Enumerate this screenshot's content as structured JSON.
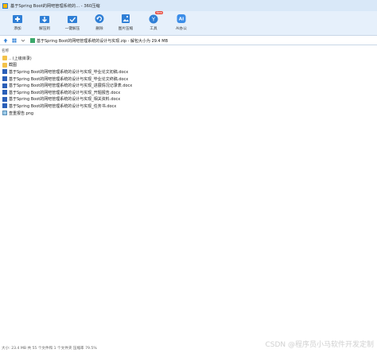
{
  "window": {
    "title": "基于Spring Boot的网吧管理系统的... - 360压缩"
  },
  "toolbar": {
    "items": [
      {
        "label": "添加",
        "icon": "add-icon"
      },
      {
        "label": "解压到",
        "icon": "extract-to-icon"
      },
      {
        "label": "一键解压",
        "icon": "one-click-extract-icon"
      },
      {
        "label": "删除",
        "icon": "delete-icon"
      },
      {
        "label": "图片压缩",
        "icon": "image-compress-icon"
      },
      {
        "label": "工具",
        "icon": "tools-icon",
        "badge": "New"
      },
      {
        "label": "AI办公",
        "icon": "ai-office-icon"
      }
    ]
  },
  "address": {
    "path": "基于Spring Boot的网吧管理系统的设计与实现.zip - 解包大小为 29.4 MB"
  },
  "list": {
    "column_name": "名称",
    "files": [
      {
        "name": ".. (上级目录)",
        "type": "folder"
      },
      {
        "name": "截图",
        "type": "folder"
      },
      {
        "name": "基于Spring Boot的网吧管理系统的设计与实现_毕业论文初稿.docx",
        "type": "doc"
      },
      {
        "name": "基于Spring Boot的网吧管理系统的设计与实现_毕业论文终稿.docx",
        "type": "doc"
      },
      {
        "name": "基于Spring Boot的网吧管理系统的设计与实现_进展情况记录表.docx",
        "type": "doc"
      },
      {
        "name": "基于Spring Boot的网吧管理系统的设计与实现_开题报告.docx",
        "type": "doc"
      },
      {
        "name": "基于Spring Boot的网吧管理系统的设计与实现_相关资料.docx",
        "type": "doc"
      },
      {
        "name": "基于Spring Boot的网吧管理系统的设计与实现_任务书.docx",
        "type": "doc"
      },
      {
        "name": "查重报告.png",
        "type": "img"
      }
    ]
  },
  "status": {
    "text": "大小: 23.4 MB 共 55 个文件和 1 个文件夹 压缩率 79.5%"
  },
  "watermark": "CSDN @程序员小马软件开发定制",
  "colors": {
    "accent": "#2f7fd6",
    "toolbar_bg": "#e6f0fb",
    "badge": "#e84a3c"
  }
}
